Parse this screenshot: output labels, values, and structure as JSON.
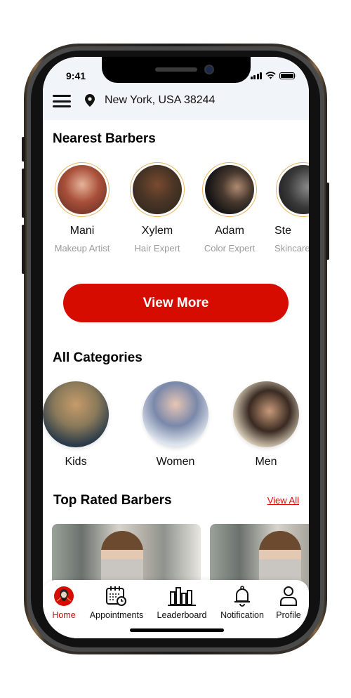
{
  "status_bar": {
    "time": "9:41"
  },
  "header": {
    "location": "New York, USA 38244",
    "menu_icon": "hamburger-menu-icon",
    "location_icon": "map-pin-icon"
  },
  "nearest_barbers": {
    "title": "Nearest Barbers",
    "items": [
      {
        "name": "Mani",
        "role": "Makeup Artist",
        "photo_color": "#8a3a2a"
      },
      {
        "name": "Xylem",
        "role": "Hair Expert",
        "photo_color": "#4a3526"
      },
      {
        "name": "Adam",
        "role": "Color Expert",
        "photo_color": "#1d1d1d"
      },
      {
        "name": "Ste",
        "role": "Skincare",
        "photo_color": "#3a3a3a"
      }
    ],
    "view_more_label": "View More"
  },
  "categories": {
    "title": "All Categories",
    "items": [
      {
        "label": "Kids",
        "photo_color": "#8a7a5a"
      },
      {
        "label": "Women",
        "photo_color": "#9aa6c0"
      },
      {
        "label": "Men",
        "photo_color": "#d8cdb4"
      }
    ]
  },
  "top_rated": {
    "title": "Top Rated Barbers",
    "view_all_label": "View All"
  },
  "bottom_nav": {
    "items": [
      {
        "label": "Home",
        "icon": "barber-avatar-icon",
        "active": true
      },
      {
        "label": "Appointments",
        "icon": "calendar-clock-icon",
        "active": false
      },
      {
        "label": "Leaderboard",
        "icon": "leaderboard-bars-icon",
        "active": false
      },
      {
        "label": "Notification",
        "icon": "bell-icon",
        "active": false
      },
      {
        "label": "Profile",
        "icon": "user-icon",
        "active": false
      }
    ]
  },
  "colors": {
    "accent": "#d60c00",
    "ring": "#e8b35a",
    "header_bg": "#f1f5f9"
  }
}
